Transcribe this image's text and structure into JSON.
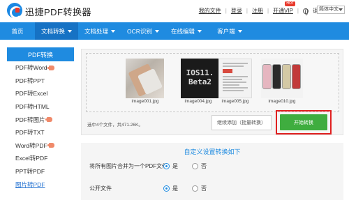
{
  "header": {
    "brand": "迅捷PDF转换器",
    "links": [
      "我的文件",
      "登录",
      "注册"
    ],
    "vip": "开通VIP",
    "hot_badge": "HOT",
    "lang_label": "语言",
    "lang_value": "简体中文"
  },
  "nav": {
    "items": [
      {
        "label": "首页",
        "dropdown": false
      },
      {
        "label": "文档转换",
        "dropdown": true
      },
      {
        "label": "文档处理",
        "dropdown": true
      },
      {
        "label": "OCR识别",
        "dropdown": true
      },
      {
        "label": "在线编辑",
        "dropdown": true
      },
      {
        "label": "客户端",
        "dropdown": true
      }
    ],
    "active_index": 1
  },
  "sidebar": {
    "title": "PDF转换",
    "items": [
      {
        "label": "PDF转Word",
        "hot": true
      },
      {
        "label": "PDF转PPT",
        "hot": false
      },
      {
        "label": "PDF转Excel",
        "hot": false
      },
      {
        "label": "PDF转HTML",
        "hot": false
      },
      {
        "label": "PDF转图片",
        "hot": true
      },
      {
        "label": "PDF转TXT",
        "hot": false
      },
      {
        "label": "Word转PDF",
        "hot": true
      },
      {
        "label": "Excel转PDF",
        "hot": false
      },
      {
        "label": "PPT转PDF",
        "hot": false
      },
      {
        "label": "图片转PDF",
        "hot": false
      }
    ],
    "active_index": 9
  },
  "upload": {
    "thumbs": [
      {
        "caption": "image001.jpg"
      },
      {
        "caption": "image004.jpg",
        "overlay_text": [
          "IOS11.",
          "Beta2"
        ]
      },
      {
        "caption": "image005.jpg"
      },
      {
        "caption": "image010.jpg"
      }
    ],
    "selection_text": "选中4个文件，共471.26K。",
    "batch_button": "继续添加（批量转换）",
    "start_button": "开始转换"
  },
  "settings": {
    "title": "自定义设置转换如下",
    "merge_label": "将所有图片合并为一个PDF文件",
    "public_label": "公开文件",
    "yes": "是",
    "no": "否",
    "merge_value": "是",
    "public_value": "是"
  },
  "colors": {
    "primary": "#1f8be0",
    "nav_active": "#1672c4",
    "start_green": "#3fad3f",
    "highlight_red": "#e01f1f"
  }
}
